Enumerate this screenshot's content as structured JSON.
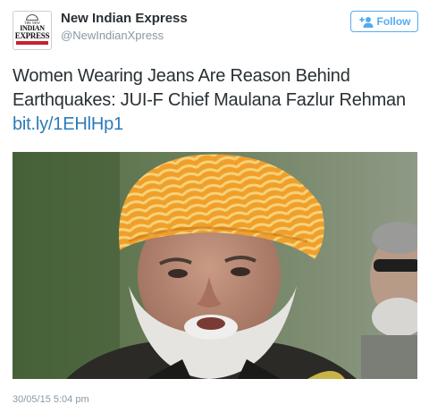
{
  "author": {
    "display_name": "New Indian Express",
    "handle": "@NewIndianXpress",
    "avatar_lines": [
      "THE NEW",
      "INDIAN",
      "EXPRESS"
    ]
  },
  "follow_button": {
    "label": "Follow",
    "icon": "add-user-icon"
  },
  "tweet": {
    "text": "Women Wearing Jeans Are Reason Behind Earthquakes: JUI-F Chief Maulana Fazlur Rehman",
    "link": "bit.ly/1EHlHp1"
  },
  "timestamp": "30/05/15 5:04 pm",
  "colors": {
    "accent": "#55acee",
    "link": "#2b7bb9",
    "muted": "#8899a6",
    "text": "#292f33",
    "brand_red": "#c8202f"
  }
}
